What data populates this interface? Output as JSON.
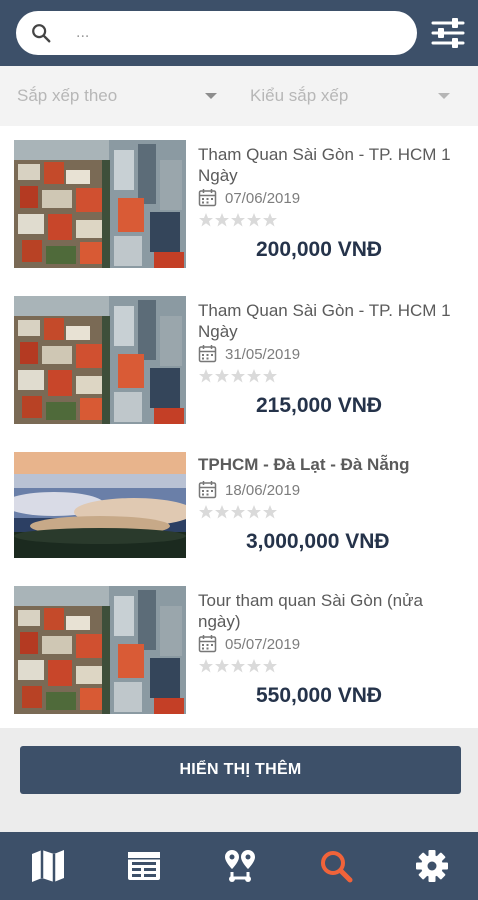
{
  "search": {
    "placeholder": "..."
  },
  "sort": {
    "sort_by_label": "Sắp xếp theo",
    "sort_type_label": "Kiểu sắp xếp"
  },
  "tours": [
    {
      "title": "Tham Quan Sài Gòn - TP. HCM 1 Ngày",
      "date": "07/06/2019",
      "rating": 0,
      "price": "200,000 VNĐ",
      "image": "saigon-city-aerial"
    },
    {
      "title": "Tham Quan Sài Gòn - TP. HCM 1 Ngày",
      "date": "31/05/2019",
      "rating": 0,
      "price": "215,000 VNĐ",
      "image": "saigon-city-aerial"
    },
    {
      "title": "TPHCM - Đà Lạt - Đà Nẵng",
      "date": "18/06/2019",
      "rating": 0,
      "price": "3,000,000 VNĐ",
      "image": "dalat-foggy-sunrise"
    },
    {
      "title": "Tour tham quan Sài Gòn (nửa ngày)",
      "date": "05/07/2019",
      "rating": 0,
      "price": "550,000 VNĐ",
      "image": "saigon-city-aerial"
    }
  ],
  "more_button_label": "HIỂN THỊ THÊM",
  "bottom_nav": [
    {
      "icon": "map-icon",
      "active": false
    },
    {
      "icon": "calendar-list-icon",
      "active": false
    },
    {
      "icon": "route-icon",
      "active": false
    },
    {
      "icon": "search-icon",
      "active": true
    },
    {
      "icon": "gear-icon",
      "active": false
    }
  ],
  "colors": {
    "primary": "#3d5069",
    "accent": "#f0633a",
    "price": "#25334a",
    "background": "#ececec"
  }
}
